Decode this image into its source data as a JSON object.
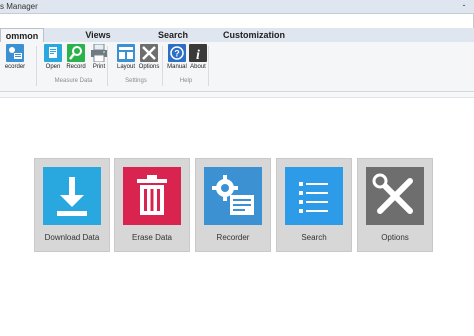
{
  "window": {
    "title": "s Manager",
    "minimize": "-"
  },
  "tabs": [
    {
      "label": "ommon"
    },
    {
      "label": "Views"
    },
    {
      "label": "Search"
    },
    {
      "label": "Customization"
    }
  ],
  "ribbon": {
    "buttons": [
      {
        "label": "ecorder",
        "icon": "recorder-icon"
      },
      {
        "label": "Open",
        "icon": "open-icon"
      },
      {
        "label": "Record",
        "icon": "record-search-icon"
      },
      {
        "label": "Print",
        "icon": "print-icon"
      },
      {
        "label": "Layout",
        "icon": "layout-icon"
      },
      {
        "label": "Options",
        "icon": "options-tools-icon"
      },
      {
        "label": "Manual",
        "icon": "manual-help-icon"
      },
      {
        "label": "About",
        "icon": "about-info-icon"
      }
    ],
    "groups": [
      {
        "label": "Measure Data"
      },
      {
        "label": "Settings"
      },
      {
        "label": "Help"
      }
    ]
  },
  "tiles": [
    {
      "label": "Download Data",
      "icon": "download-icon",
      "color": "#29a8e0"
    },
    {
      "label": "Erase Data",
      "icon": "trash-icon",
      "color": "#d9244f"
    },
    {
      "label": "Recorder",
      "icon": "recorder-gear-icon",
      "color": "#3b91d2"
    },
    {
      "label": "Search",
      "icon": "list-icon",
      "color": "#2e9be8"
    },
    {
      "label": "Options",
      "icon": "tools-icon",
      "color": "#6e6e6e"
    }
  ]
}
